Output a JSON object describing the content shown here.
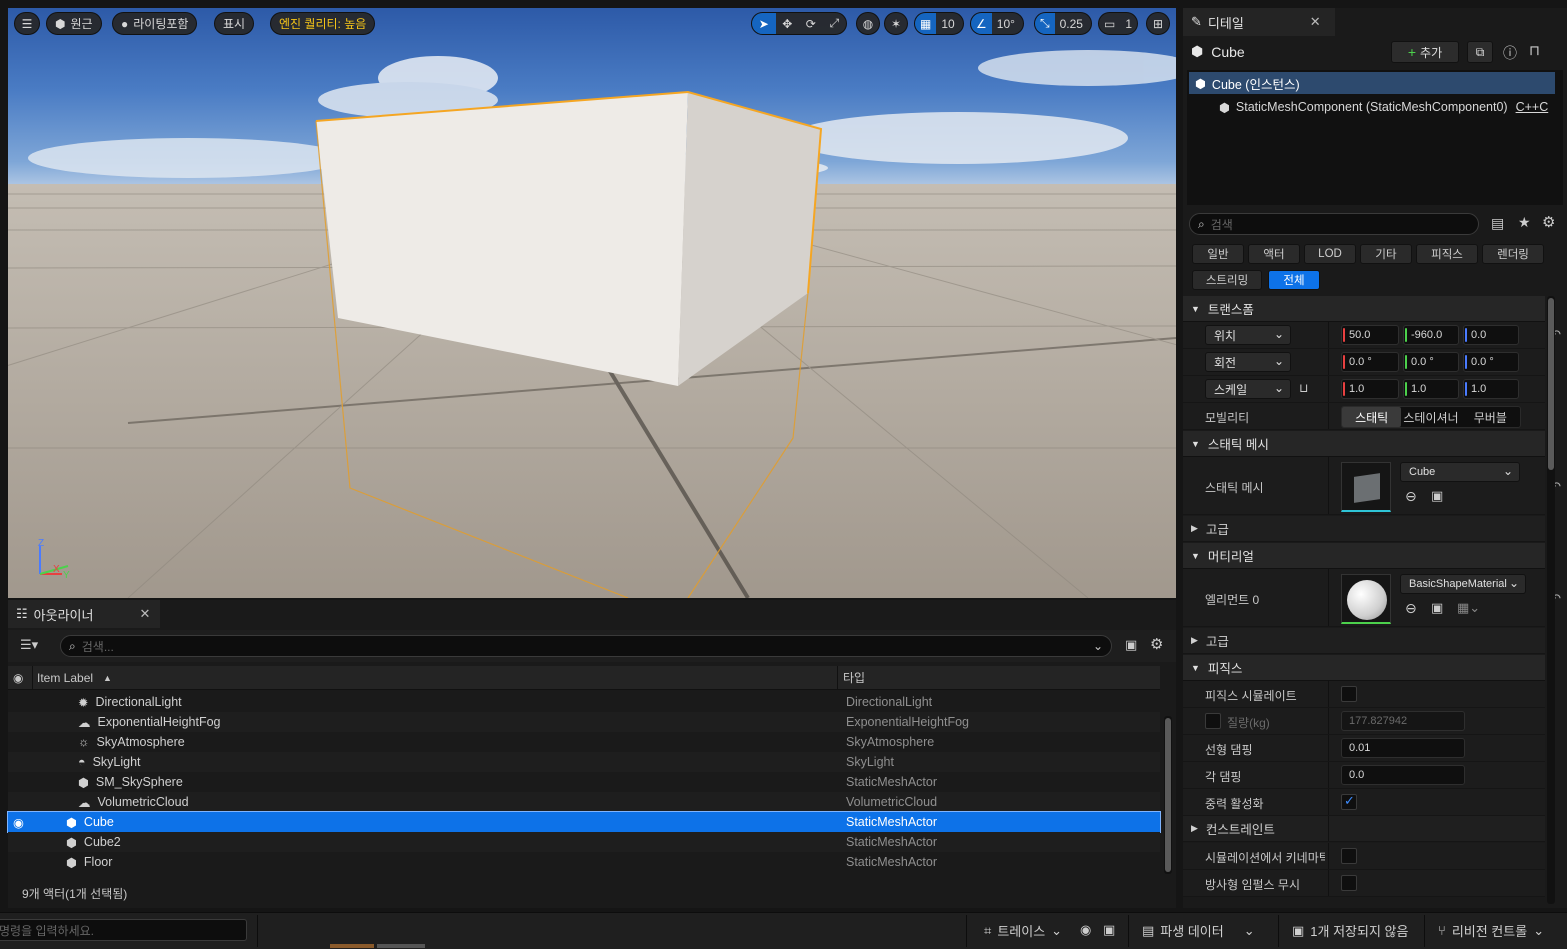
{
  "viewport": {
    "menu_icon": "hamburger-icon",
    "perspective_label": "원근",
    "lighting_label": "라이팅포함",
    "show_label": "표시",
    "quality_label": "엔진 퀄리티: 높음",
    "grid_snap": "10",
    "rotation_snap": "10°",
    "scale_snap": "0.25",
    "camera_speed": "1",
    "axis": {
      "z": "Z",
      "x": "X",
      "y": "Y"
    },
    "colors": {
      "selection_outline": "#f5a623",
      "accent": "#1565c0",
      "warning": "#f5c518"
    }
  },
  "outliner": {
    "tab_label": "아웃라이너",
    "search_placeholder": "검색...",
    "col_label": "Item Label",
    "col_type": "타입",
    "rows": [
      {
        "label": "DirectionalLight",
        "type": "DirectionalLight",
        "icon": "sun-light-icon"
      },
      {
        "label": "ExponentialHeightFog",
        "type": "ExponentialHeightFog",
        "icon": "fog-icon"
      },
      {
        "label": "SkyAtmosphere",
        "type": "SkyAtmosphere",
        "icon": "sky-atmosphere-icon"
      },
      {
        "label": "SkyLight",
        "type": "SkyLight",
        "icon": "sky-light-icon"
      },
      {
        "label": "SM_SkySphere",
        "type": "StaticMeshActor",
        "icon": "static-mesh-icon"
      },
      {
        "label": "VolumetricCloud",
        "type": "VolumetricCloud",
        "icon": "cloud-icon"
      },
      {
        "label": "Cube",
        "type": "StaticMeshActor",
        "icon": "static-mesh-icon",
        "selected": true
      },
      {
        "label": "Cube2",
        "type": "StaticMeshActor",
        "icon": "static-mesh-icon"
      },
      {
        "label": "Floor",
        "type": "StaticMeshActor",
        "icon": "static-mesh-icon"
      }
    ],
    "status": "9개 액터(1개 선택됨)"
  },
  "details": {
    "tab_label": "디테일",
    "object_name": "Cube",
    "add_label": "추가",
    "instance_label": "Cube (인스턴스)",
    "component_label": "StaticMeshComponent (StaticMeshComponent0)",
    "component_link": "C++C",
    "search_placeholder": "검색",
    "filters": [
      "일반",
      "액터",
      "LOD",
      "기타",
      "피직스",
      "렌더링",
      "스트리밍",
      "전체"
    ],
    "transform": {
      "title": "트랜스폼",
      "location_label": "위치",
      "rotation_label": "회전",
      "scale_label": "스케일",
      "location": [
        "50.0",
        "-960.0",
        "0.0"
      ],
      "rotation": [
        "0.0 °",
        "0.0 °",
        "0.0 °"
      ],
      "scale": [
        "1.0",
        "1.0",
        "1.0"
      ],
      "mobility_label": "모빌리티",
      "mobility_options": [
        "스태틱",
        "스테이셔너",
        "무버블"
      ]
    },
    "static_mesh": {
      "title": "스태틱 메시",
      "prop_label": "스태틱 메시",
      "value": "Cube",
      "advanced": "고급"
    },
    "materials": {
      "title": "머티리얼",
      "element_label": "엘리먼트 0",
      "value": "BasicShapeMaterial",
      "advanced": "고급"
    },
    "physics": {
      "title": "피직스",
      "simulate_label": "피직스 시뮬레이트",
      "mass_label": "질량(kg)",
      "mass_value": "177.827942",
      "linear_damping_label": "선형 댐핑",
      "linear_damping": "0.01",
      "angular_damping_label": "각 댐핑",
      "angular_damping": "0.0",
      "gravity_label": "중력 활성화",
      "constraints_label": "컨스트레인트",
      "kinematic_label": "시뮬레이션에서 키네마틱...",
      "radial_label": "방사형 임펄스 무시"
    }
  },
  "bottombar": {
    "cmd_placeholder": "명령을 입력하세요.",
    "trace_label": "트레이스",
    "derived_data_label": "파생 데이터",
    "unsaved_label": "1개 저장되지 않음",
    "revision_label": "리비전 컨트롤"
  }
}
